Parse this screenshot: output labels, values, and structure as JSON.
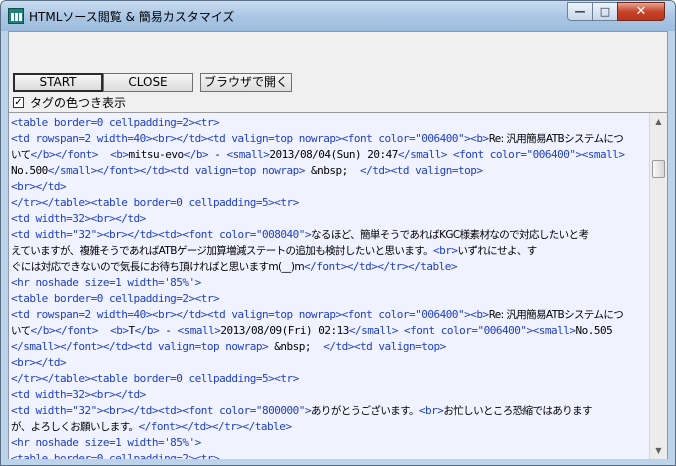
{
  "window": {
    "title": "HTMLソース閲覧 & 簡易カスタマイズ",
    "min_glyph": "—",
    "max_glyph": "□",
    "close_glyph": "✕"
  },
  "toolbar": {
    "start_label": "START",
    "close_label": "CLOSE",
    "browser_label": "ブラウザで開く"
  },
  "option": {
    "checked_glyph": "✓",
    "label": "タグの色つき表示",
    "checked": true
  },
  "scrollbar": {
    "up_glyph": "▲",
    "down_glyph": "▼"
  },
  "colors": {
    "tag": "#1d3fc6",
    "text": "#000000",
    "editor_bg": "#f1f2ff"
  },
  "source_lines": [
    [
      {
        "k": "t",
        "v": "<table border=0 cellpadding=2><tr>"
      }
    ],
    [
      {
        "k": "t",
        "v": "<td rowspan=2 width=40><br></td><td valign=top nowrap><font color=\"006400\"><b>"
      },
      {
        "k": "x",
        "v": "Re: 汎用簡易ATBシステムにつ"
      }
    ],
    [
      {
        "k": "x",
        "v": "いて"
      },
      {
        "k": "t",
        "v": "</b></font>"
      },
      {
        "k": "x",
        "v": "  "
      },
      {
        "k": "t",
        "v": "<b>"
      },
      {
        "k": "x",
        "v": "mitsu-evo"
      },
      {
        "k": "t",
        "v": "</b>"
      },
      {
        "k": "x",
        "v": " - "
      },
      {
        "k": "t",
        "v": "<small>"
      },
      {
        "k": "x",
        "v": "2013/08/04(Sun) 20:47"
      },
      {
        "k": "t",
        "v": "</small>"
      },
      {
        "k": "x",
        "v": " "
      },
      {
        "k": "t",
        "v": "<font color=\"006400\"><small>"
      }
    ],
    [
      {
        "k": "x",
        "v": "No.500"
      },
      {
        "k": "t",
        "v": "</small></font></td><td valign=top nowrap>"
      },
      {
        "k": "x",
        "v": " &nbsp;  "
      },
      {
        "k": "t",
        "v": "</td><td valign=top>"
      }
    ],
    [
      {
        "k": "t",
        "v": "<br></td>"
      }
    ],
    [
      {
        "k": "t",
        "v": "</tr></table><table border=0 cellpadding=5><tr>"
      }
    ],
    [
      {
        "k": "t",
        "v": "<td width=32><br></td>"
      }
    ],
    [
      {
        "k": "t",
        "v": "<td width=\"32\"><br></td><td><font color=\"008040\">"
      },
      {
        "k": "x",
        "v": "なるほど、簡単そうであればKGC様素材なので対応したいと考"
      }
    ],
    [
      {
        "k": "x",
        "v": "えていますが、複雑そうであればATBゲージ加算増減ステートの追加も検討したいと思います。"
      },
      {
        "k": "t",
        "v": "<br>"
      },
      {
        "k": "x",
        "v": "いずれにせよ、す"
      }
    ],
    [
      {
        "k": "x",
        "v": "ぐには対応できないので気長にお待ち頂ければと思いますm(__)m"
      },
      {
        "k": "t",
        "v": "</font></td></tr></table>"
      }
    ],
    [
      {
        "k": "t",
        "v": "<hr noshade size=1 width='85%'>"
      }
    ],
    [
      {
        "k": "t",
        "v": "<table border=0 cellpadding=2><tr>"
      }
    ],
    [
      {
        "k": "t",
        "v": "<td rowspan=2 width=40><br></td><td valign=top nowrap><font color=\"006400\"><b>"
      },
      {
        "k": "x",
        "v": "Re: 汎用簡易ATBシステムにつ"
      }
    ],
    [
      {
        "k": "x",
        "v": "いて"
      },
      {
        "k": "t",
        "v": "</b></font>"
      },
      {
        "k": "x",
        "v": "  "
      },
      {
        "k": "t",
        "v": "<b>"
      },
      {
        "k": "x",
        "v": "T"
      },
      {
        "k": "t",
        "v": "</b>"
      },
      {
        "k": "x",
        "v": " - "
      },
      {
        "k": "t",
        "v": "<small>"
      },
      {
        "k": "x",
        "v": "2013/08/09(Fri) 02:13"
      },
      {
        "k": "t",
        "v": "</small>"
      },
      {
        "k": "x",
        "v": " "
      },
      {
        "k": "t",
        "v": "<font color=\"006400\"><small>"
      },
      {
        "k": "x",
        "v": "No.505"
      }
    ],
    [
      {
        "k": "t",
        "v": "</small></font></td><td valign=top nowrap>"
      },
      {
        "k": "x",
        "v": " &nbsp;  "
      },
      {
        "k": "t",
        "v": "</td><td valign=top>"
      }
    ],
    [
      {
        "k": "t",
        "v": "<br></td>"
      }
    ],
    [
      {
        "k": "t",
        "v": "</tr></table><table border=0 cellpadding=5><tr>"
      }
    ],
    [
      {
        "k": "t",
        "v": "<td width=32><br></td>"
      }
    ],
    [
      {
        "k": "t",
        "v": "<td width=\"32\"><br></td><td><font color=\"800000\">"
      },
      {
        "k": "x",
        "v": "ありがとうございます。"
      },
      {
        "k": "t",
        "v": "<br>"
      },
      {
        "k": "x",
        "v": "お忙しいところ恐縮ではあります"
      }
    ],
    [
      {
        "k": "x",
        "v": "が、よろしくお願いします。"
      },
      {
        "k": "t",
        "v": "</font></td></tr></table>"
      }
    ],
    [
      {
        "k": "t",
        "v": "<hr noshade size=1 width='85%'>"
      }
    ],
    [
      {
        "k": "t",
        "v": "<table border=0 cellpadding=2><tr>"
      }
    ]
  ]
}
